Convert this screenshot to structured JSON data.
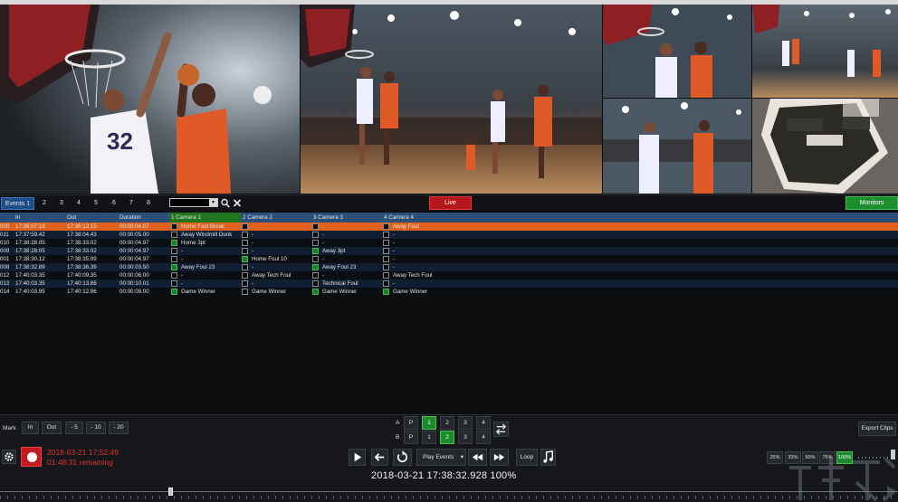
{
  "window": {
    "title_fragment": ""
  },
  "tabs": [
    {
      "label": "Events 1",
      "active": true
    },
    {
      "label": "2"
    },
    {
      "label": "3"
    },
    {
      "label": "4"
    },
    {
      "label": "5"
    },
    {
      "label": "6"
    },
    {
      "label": "7"
    },
    {
      "label": "8"
    }
  ],
  "toolbar": {
    "live_label": "Live",
    "monitors_label": "Monitors",
    "search_value": ""
  },
  "table": {
    "headers": {
      "in": "In",
      "out": "Out",
      "duration": "Duration",
      "cam1": "1 Camera 1",
      "cam2": "2 Camera 2",
      "cam3": "3 Camera 3",
      "cam4": "4 Camera 4"
    },
    "rows": [
      {
        "id": "000",
        "in": "17:36:07.18",
        "out": "17:36:12.15",
        "dur": "00:00:04.97",
        "c1": {
          "on": false,
          "t": "Home Fast Break"
        },
        "c2": {
          "on": false,
          "t": "-"
        },
        "c3": {
          "on": false,
          "t": "-"
        },
        "c4": {
          "on": false,
          "t": "Away Foul"
        }
      },
      {
        "id": "011",
        "in": "17:37:59.42",
        "out": "17:38:04.43",
        "dur": "00:00:05.00",
        "c1": {
          "on": false,
          "t": "Away Windmill Dunk"
        },
        "c2": {
          "on": false,
          "t": "-"
        },
        "c3": {
          "on": false,
          "t": "-"
        },
        "c4": {
          "on": false,
          "t": "-"
        }
      },
      {
        "id": "010",
        "in": "17:38:28.05",
        "out": "17:38:33.02",
        "dur": "00:00:04.97",
        "c1": {
          "on": true,
          "t": "Home 3pt"
        },
        "c2": {
          "on": false,
          "t": "-"
        },
        "c3": {
          "on": false,
          "t": "-"
        },
        "c4": {
          "on": false,
          "t": "-"
        }
      },
      {
        "id": "009",
        "in": "17:38:28.05",
        "out": "17:38:33.02",
        "dur": "00:00:04.97",
        "c1": {
          "on": false,
          "t": "-"
        },
        "c2": {
          "on": false,
          "t": "-"
        },
        "c3": {
          "on": true,
          "t": "Away 3pt"
        },
        "c4": {
          "on": false,
          "t": "-"
        }
      },
      {
        "id": "001",
        "in": "17:38:30.12",
        "out": "17:38:35.09",
        "dur": "00:00:04.97",
        "c1": {
          "on": false,
          "t": "-"
        },
        "c2": {
          "on": true,
          "t": "Home Foul 10"
        },
        "c3": {
          "on": false,
          "t": "-"
        },
        "c4": {
          "on": false,
          "t": "-"
        }
      },
      {
        "id": "008",
        "in": "17:38:32.89",
        "out": "17:38:36.39",
        "dur": "00:00:03.50",
        "c1": {
          "on": true,
          "t": "Away Foul 23"
        },
        "c2": {
          "on": false,
          "t": "-"
        },
        "c3": {
          "on": true,
          "t": "Away Foul 23"
        },
        "c4": {
          "on": false,
          "t": "-"
        }
      },
      {
        "id": "012",
        "in": "17:40:03.35",
        "out": "17:40:09.35",
        "dur": "00:00:06.00",
        "c1": {
          "on": false,
          "t": "-"
        },
        "c2": {
          "on": false,
          "t": "Away Tech Foul"
        },
        "c3": {
          "on": false,
          "t": "-"
        },
        "c4": {
          "on": false,
          "t": "Away Tech Foul"
        }
      },
      {
        "id": "013",
        "in": "17:40:03.35",
        "out": "17:40:13.66",
        "dur": "00:00:10.01",
        "c1": {
          "on": false,
          "t": "-"
        },
        "c2": {
          "on": false,
          "t": "-"
        },
        "c3": {
          "on": false,
          "t": "Technical Foul"
        },
        "c4": {
          "on": false,
          "t": "-"
        }
      },
      {
        "id": "014",
        "in": "17:40:03.95",
        "out": "17:40:12.96",
        "dur": "00:00:09.00",
        "c1": {
          "on": true,
          "t": "Game Winner"
        },
        "c2": {
          "on": false,
          "t": "Game Winner"
        },
        "c3": {
          "on": true,
          "t": "Game Winner"
        },
        "c4": {
          "on": true,
          "t": "Game Winner"
        }
      }
    ]
  },
  "controls": {
    "mark_label": "Mark",
    "mark_buttons": [
      "In",
      "Out",
      "- 5",
      "- 10",
      "- 20"
    ],
    "row_a_label": "A",
    "row_b_label": "B",
    "p_label": "P",
    "channels": [
      "1",
      "2",
      "3",
      "4"
    ],
    "channel_a_active": "1",
    "channel_b_active": "2",
    "play_events_label": "Play Events",
    "loop_label": "Loop",
    "export_label": "Export Clips",
    "speeds": [
      "25%",
      "33%",
      "50%",
      "75%",
      "100%"
    ],
    "speed_active": "100%",
    "record_time": "2018-03-21  17:52:49",
    "record_remaining": "01:48:31 remaining",
    "timecode": "2018-03-21  17:38:32.928   100%",
    "scrub_position": 0.188
  },
  "colors": {
    "accent_blue": "#1c4f8a",
    "live_red": "#b3161b",
    "monitor_green": "#1d8d2e",
    "selected_row": "#e0621d"
  }
}
